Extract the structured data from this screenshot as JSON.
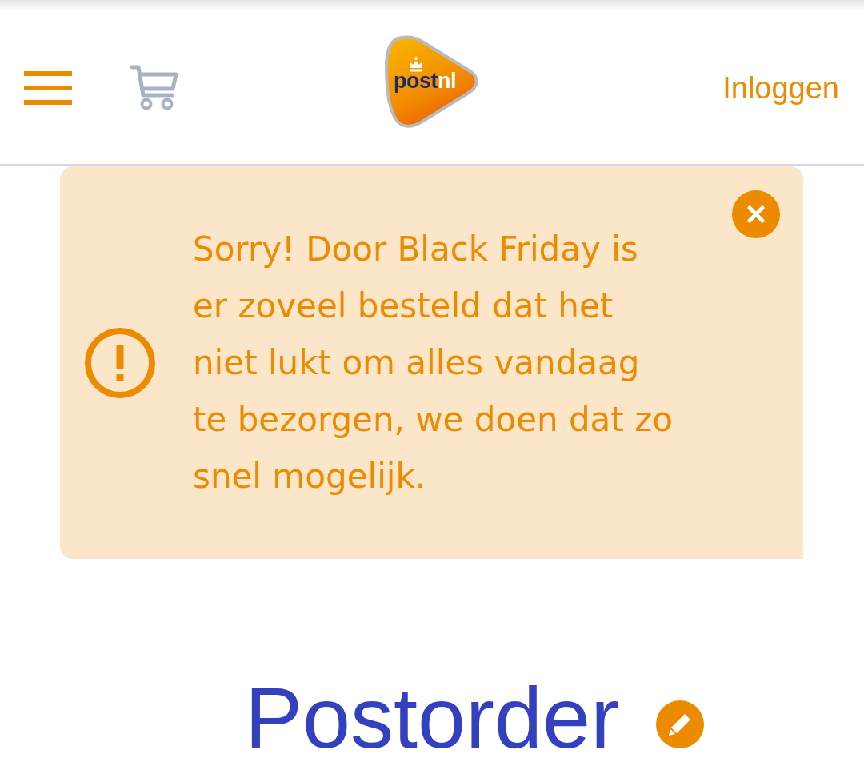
{
  "header": {
    "logo": {
      "parts": [
        "post",
        "nl"
      ]
    },
    "login_link": "Inloggen"
  },
  "alert": {
    "message": "Sorry! Door Black Friday is er zoveel besteld dat het niet lukt om alles vandaag te bezorgen, we doen dat zo snel mogelijk."
  },
  "page_title": "Postorder"
}
